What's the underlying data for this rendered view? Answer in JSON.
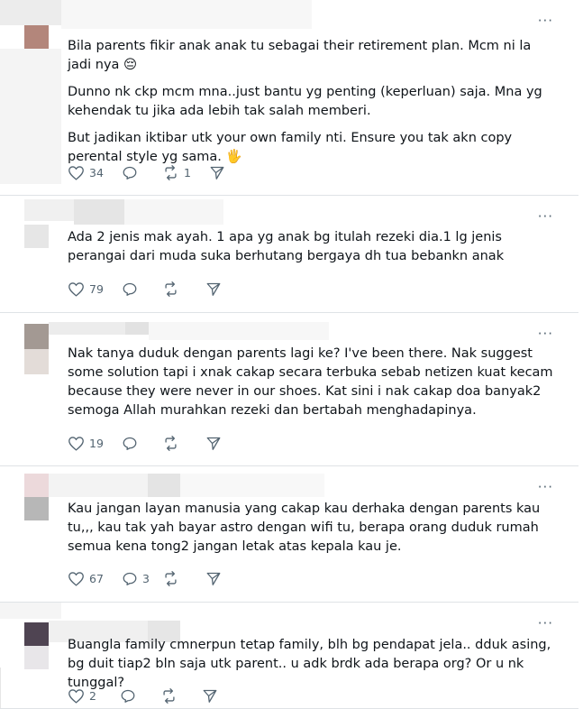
{
  "more_label": "···",
  "icons": {
    "like": "heart-icon",
    "reply": "reply-bubble-icon",
    "repost": "repost-icon",
    "share": "share-arrow-icon",
    "more": "more-dots-icon"
  },
  "colors": {
    "text": "#0f1419",
    "muted": "#536471",
    "divider": "#dfe3e6"
  },
  "posts": [
    {
      "paragraphs": [
        "Bila parents fikir anak anak tu sebagai their retirement plan. Mcm ni la jadi nya 😔",
        "Dunno nk ckp mcm mna..just bantu yg penting (keperluan) saja. Mna yg kehendak tu jika ada lebih tak salah memberi.",
        "But jadikan iktibar utk your own family nti. Ensure you tak akn copy perental style yg sama. 🖐"
      ],
      "likes": "34",
      "replies": "",
      "reposts": "1"
    },
    {
      "paragraphs": [
        "Ada 2 jenis mak ayah. 1 apa yg anak bg itulah rezeki dia.1 lg jenis perangai dari muda suka berhutang bergaya dh tua bebankn anak"
      ],
      "likes": "79",
      "replies": "",
      "reposts": ""
    },
    {
      "paragraphs": [
        "Nak tanya duduk dengan parents lagi ke? I've been there. Nak suggest some solution tapi i xnak cakap secara terbuka sebab netizen kuat kecam because they were never in our shoes. Kat sini i nak cakap doa banyak2 semoga Allah murahkan rezeki dan bertabah menghadapinya."
      ],
      "likes": "19",
      "replies": "",
      "reposts": ""
    },
    {
      "paragraphs": [
        "Kau jangan layan manusia yang cakap kau derhaka dengan parents kau tu,,, kau tak yah bayar astro dengan wifi tu, berapa orang duduk rumah semua kena tong2 jangan letak atas kepala kau je."
      ],
      "likes": "67",
      "replies": "3",
      "reposts": ""
    },
    {
      "paragraphs": [
        "Buangla family cmnerpun tetap family, blh bg pendapat jela.. dduk asing, bg duit tiap2 bln saja utk parent.. u adk brdk ada berapa org? Or u nk tunggal?"
      ],
      "likes": "2",
      "replies": "",
      "reposts": ""
    }
  ]
}
